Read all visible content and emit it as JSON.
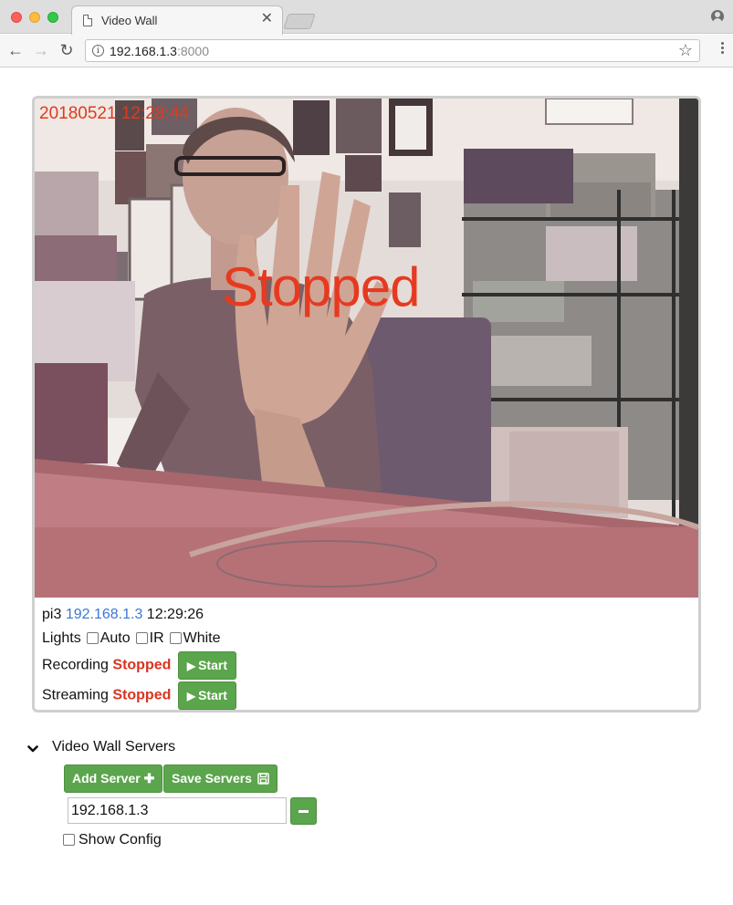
{
  "browser": {
    "tab_title": "Video Wall",
    "tab_close": "✕",
    "url_host": "192.168.1.3",
    "url_port": ":8000",
    "back_glyph": "←",
    "forward_glyph": "→",
    "reload_glyph": "↻",
    "info_glyph": "i",
    "star_glyph": "☆"
  },
  "camera": {
    "overlay_timestamp": "20180521 12:28:44",
    "overlay_status": "Stopped",
    "name": "pi3",
    "ip": "192.168.1.3",
    "time": "12:29:26",
    "lights_label": "Lights",
    "lights_options": [
      "Auto",
      "IR",
      "White"
    ],
    "recording_label": "Recording",
    "recording_status": "Stopped",
    "streaming_label": "Streaming",
    "streaming_status": "Stopped",
    "start_label": "Start",
    "status_color": "#d9341f",
    "link_color": "#3b78d8"
  },
  "servers": {
    "section_title": "Video Wall Servers",
    "add_label": "Add Server",
    "save_label": "Save Servers",
    "server_value": "192.168.1.3",
    "show_config_label": "Show Config",
    "button_color": "#5ba54c"
  }
}
